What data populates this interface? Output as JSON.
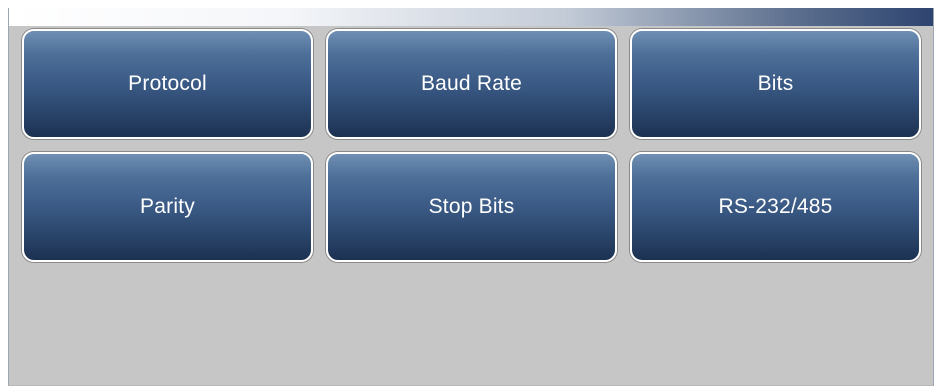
{
  "buttons": [
    {
      "label": "Protocol"
    },
    {
      "label": "Baud Rate"
    },
    {
      "label": "Bits"
    },
    {
      "label": "Parity"
    },
    {
      "label": "Stop Bits"
    },
    {
      "label": "RS-232/485"
    }
  ],
  "colors": {
    "background": "#c6c6c6",
    "button_top": "#6f8fb3",
    "button_bottom": "#1c3152",
    "button_border": "#ffffff",
    "label_text": "#ffffff"
  }
}
